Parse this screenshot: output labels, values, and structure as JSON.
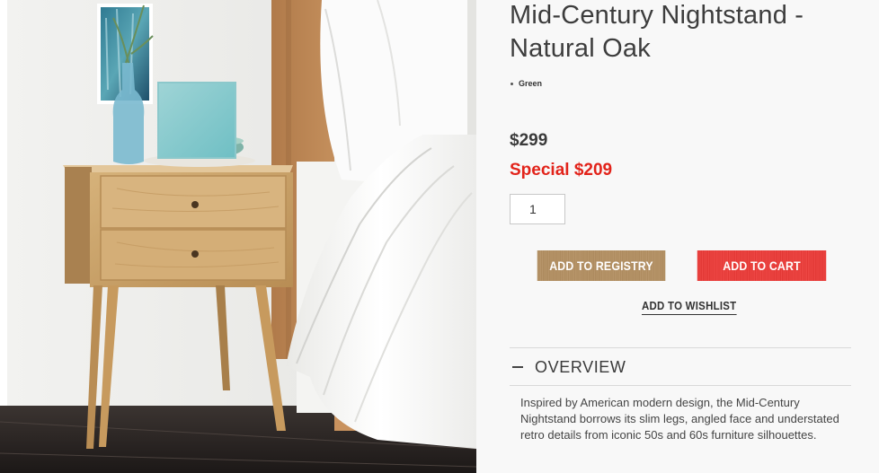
{
  "product": {
    "title": "Mid-Century Nightstand - Natural Oak",
    "color_option": "Green",
    "price_regular": "$299",
    "price_special": "Special $209",
    "image_alt": "Mid-Century Nightstand - Natural Oak"
  },
  "quantity": {
    "value": "1"
  },
  "actions": {
    "add_to_registry": "Add to Registry",
    "add_to_cart": "Add to Cart",
    "add_to_wishlist": "Add to Wishlist"
  },
  "overview": {
    "heading": "OVERVIEW",
    "text": "Inspired by American modern design, the Mid-Century Nightstand borrows its slim legs, angled face and understated retro details from iconic 50s and 60s furniture silhouettes."
  },
  "colors": {
    "special_price": "#e2231a",
    "registry_button": "#b38f62",
    "cart_button": "#ec3b38"
  },
  "icons": {
    "overview_toggle": "minus-icon"
  }
}
